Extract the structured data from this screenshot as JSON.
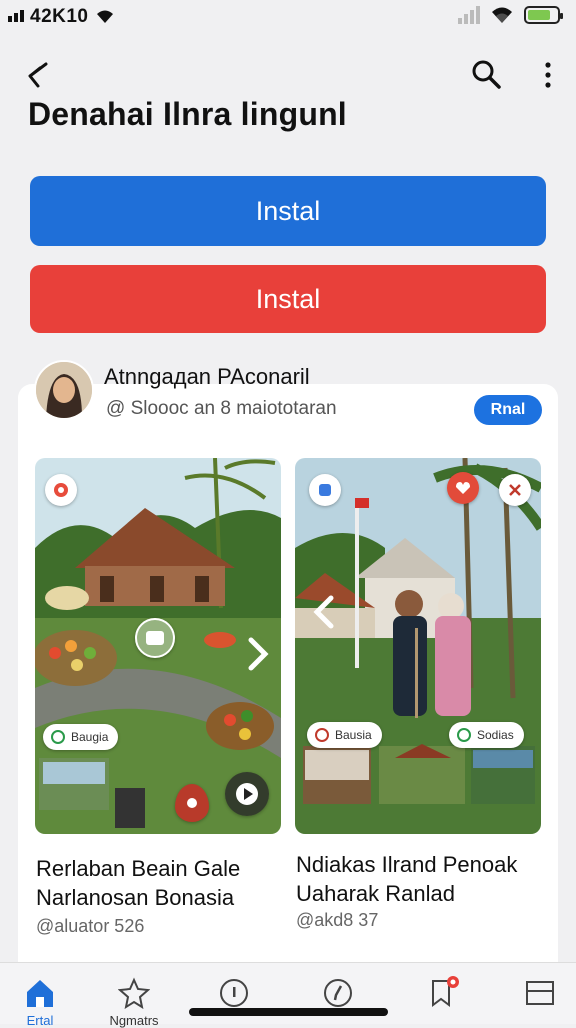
{
  "status_bar": {
    "time": "42K10"
  },
  "header": {
    "title": "Denahai Ilnra lingunl"
  },
  "actions": {
    "primary_label": "Instal",
    "secondary_label": "Instal"
  },
  "author": {
    "name": "Atnngaдan PAconaril",
    "subtitle": "@ Sloooc an 8 maiototaran",
    "follow_label": "Rnal"
  },
  "tiles": [
    {
      "pill_label": "Baugiа",
      "title_line1": "Rerlaban Beain Gale",
      "title_line2": "Narlanosan Bonasia",
      "handle": "@aluator 526"
    },
    {
      "pill_label_left": "Bausia",
      "pill_label_right": "Sodias",
      "title_line1": "Ndiakas Ilrand Penoak",
      "title_line2": "Uaharak Ranlad",
      "handle": "@akd8 37"
    }
  ],
  "bottom_nav": {
    "items": [
      {
        "label": "Ertal",
        "icon": "home-icon"
      },
      {
        "label": "Ngmatrs",
        "icon": "star-icon"
      },
      {
        "label": "",
        "icon": "info-icon"
      },
      {
        "label": "",
        "icon": "compass-icon"
      },
      {
        "label": "",
        "icon": "bookmark-icon"
      },
      {
        "label": "",
        "icon": "window-icon"
      }
    ]
  },
  "colors": {
    "primary": "#1f6fd8",
    "danger": "#e8403a",
    "accent": "#1d72e0"
  }
}
